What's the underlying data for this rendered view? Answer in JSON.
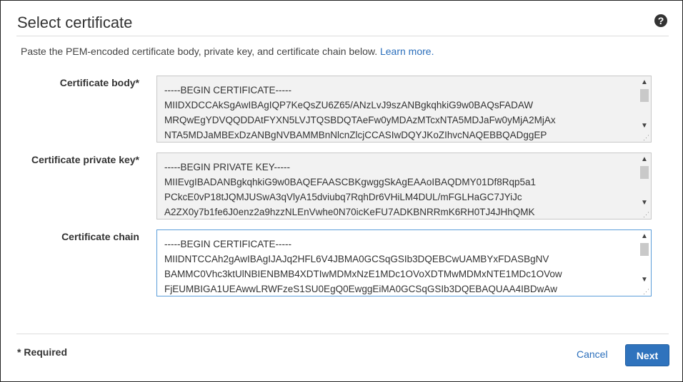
{
  "header": {
    "title": "Select certificate",
    "help_icon": "help-circle-icon",
    "help_glyph": "?"
  },
  "intro": {
    "text": "Paste the PEM-encoded certificate body, private key, and certificate chain below.",
    "link": "Learn more."
  },
  "fields": [
    {
      "label": "Certificate body*",
      "lines": [
        "-----BEGIN CERTIFICATE-----",
        "MIIDXDCCAkSgAwIBAgIQP7KeQsZU6Z65/ANzLvJ9szANBgkqhkiG9w0BAQsFADAW",
        "MRQwEgYDVQQDDAtFYXN5LVJTQSBDQTAeFw0yMDAzMTcxNTA5MDJaFw0yMjA2MjAx",
        "NTA5MDJaMBExDzANBgNVBAMMBnNlcnZlcjCCASIwDQYJKoZIhvcNAQEBBQADggEP"
      ]
    },
    {
      "label": "Certificate private key*",
      "lines": [
        "-----BEGIN PRIVATE KEY-----",
        "MIIEvgIBADANBgkqhkiG9w0BAQEFAASCBKgwggSkAgEAAoIBAQDMY01Df8Rqp5a1",
        "PCkcE0vP18tJQMJUSwA3qVlyA15dviubq7RqhDr6VHiLM4DUL/mFGLHaGC7JYiJc",
        "A2ZX0y7b1fe6J0enz2a9hzzNLEnVwhe0N70icKeFU7ADKBNRRmK6RH0TJ4JHhQMK"
      ]
    },
    {
      "label": "Certificate chain",
      "lines": [
        "-----BEGIN CERTIFICATE-----",
        "MIIDNTCCAh2gAwIBAgIJAJq2HFL6V4JBMA0GCSqGSIb3DQEBCwUAMBYxFDASBgNV",
        "BAMMC0Vhc3ktUlNBIENBMB4XDTIwMDMxNzE1MDc1OVoXDTMwMDMxNTE1MDc1OVow",
        "FjEUMBIGA1UEAwwLRWFzeS1SU0EgQ0EwggEiMA0GCSqGSIb3DQEBAQUAA4IBDwAw"
      ]
    }
  ],
  "scroll_glyphs": {
    "up": "▲",
    "down": "▼",
    "grip": "⋰"
  },
  "footer": {
    "required": "* Required",
    "cancel_label": "Cancel",
    "next_label": "Next"
  },
  "colors": {
    "link": "#2a6ebb",
    "primary_button": "#2f73bd",
    "focus_border": "#5b9dd9"
  }
}
